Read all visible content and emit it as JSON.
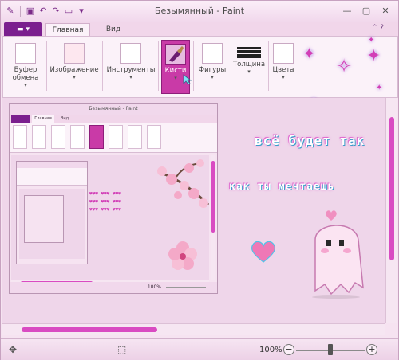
{
  "window": {
    "title": "Безымянный - Paint"
  },
  "tabs": {
    "home": "Главная",
    "view": "Вид"
  },
  "ribbon": {
    "clipboard": "Буфер обмена",
    "image": "Изображение",
    "tools": "Инструменты",
    "brushes": "Кисти",
    "shapes": "Фигуры",
    "size": "Толщина",
    "colors": "Цвета"
  },
  "art": {
    "line1": "всё будет так",
    "line2": "как ты мечтаешь",
    "small_lines": [
      "♥♥♥ ♥♥♥ ♥♥♥",
      "♥♥♥ ♥♥♥ ♥♥♥",
      "♥♥♥ ♥♥♥ ♥♥♥"
    ]
  },
  "nested": {
    "title": "Безымянный - Paint",
    "tab_home": "Главная",
    "tab_view": "Вид",
    "zoom": "100%"
  },
  "statusbar": {
    "zoom": "100%",
    "zoom_level": 0.5
  },
  "colors": {
    "accent": "#7b1f8e",
    "selected_tool": "#c93aa7",
    "scroll": "#d94bc2",
    "background": "#f2d9ee"
  }
}
